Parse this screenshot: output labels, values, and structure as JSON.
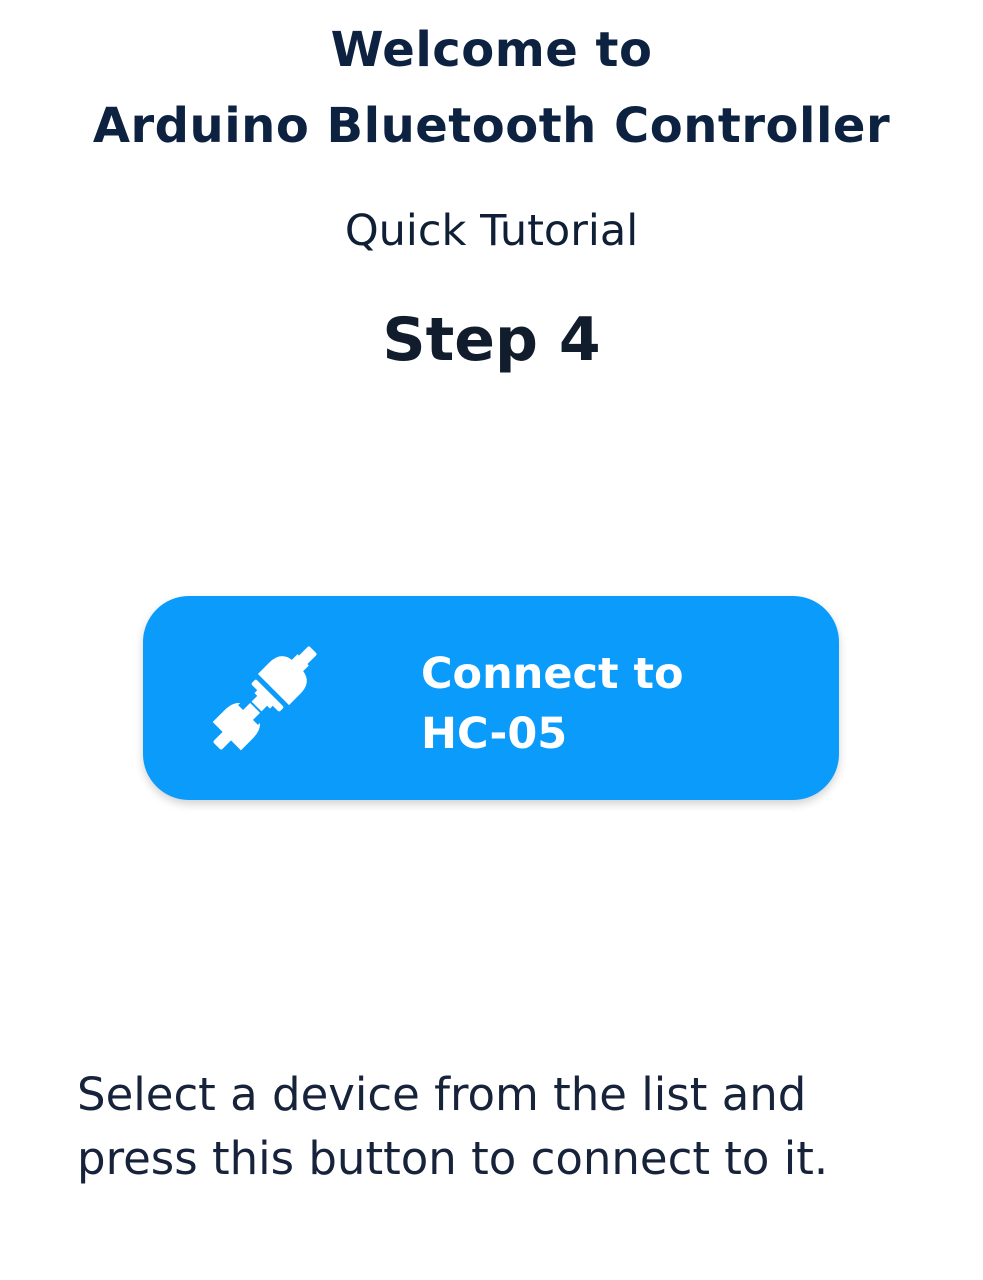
{
  "header": {
    "welcome_line1": "Welcome to",
    "welcome_line2": "Arduino Bluetooth Controller",
    "subtitle": "Quick Tutorial",
    "step": "Step 4"
  },
  "connect_button": {
    "icon": "plug-connect-icon",
    "label_line1": "Connect to",
    "label_line2": "HC-05",
    "color": "#0a9bfb"
  },
  "description": {
    "line1": "Select a device from the list and",
    "line2": "press this button to connect to it."
  },
  "colors": {
    "text": "#0d2240",
    "accent": "#0a9bfb",
    "background": "#ffffff"
  }
}
